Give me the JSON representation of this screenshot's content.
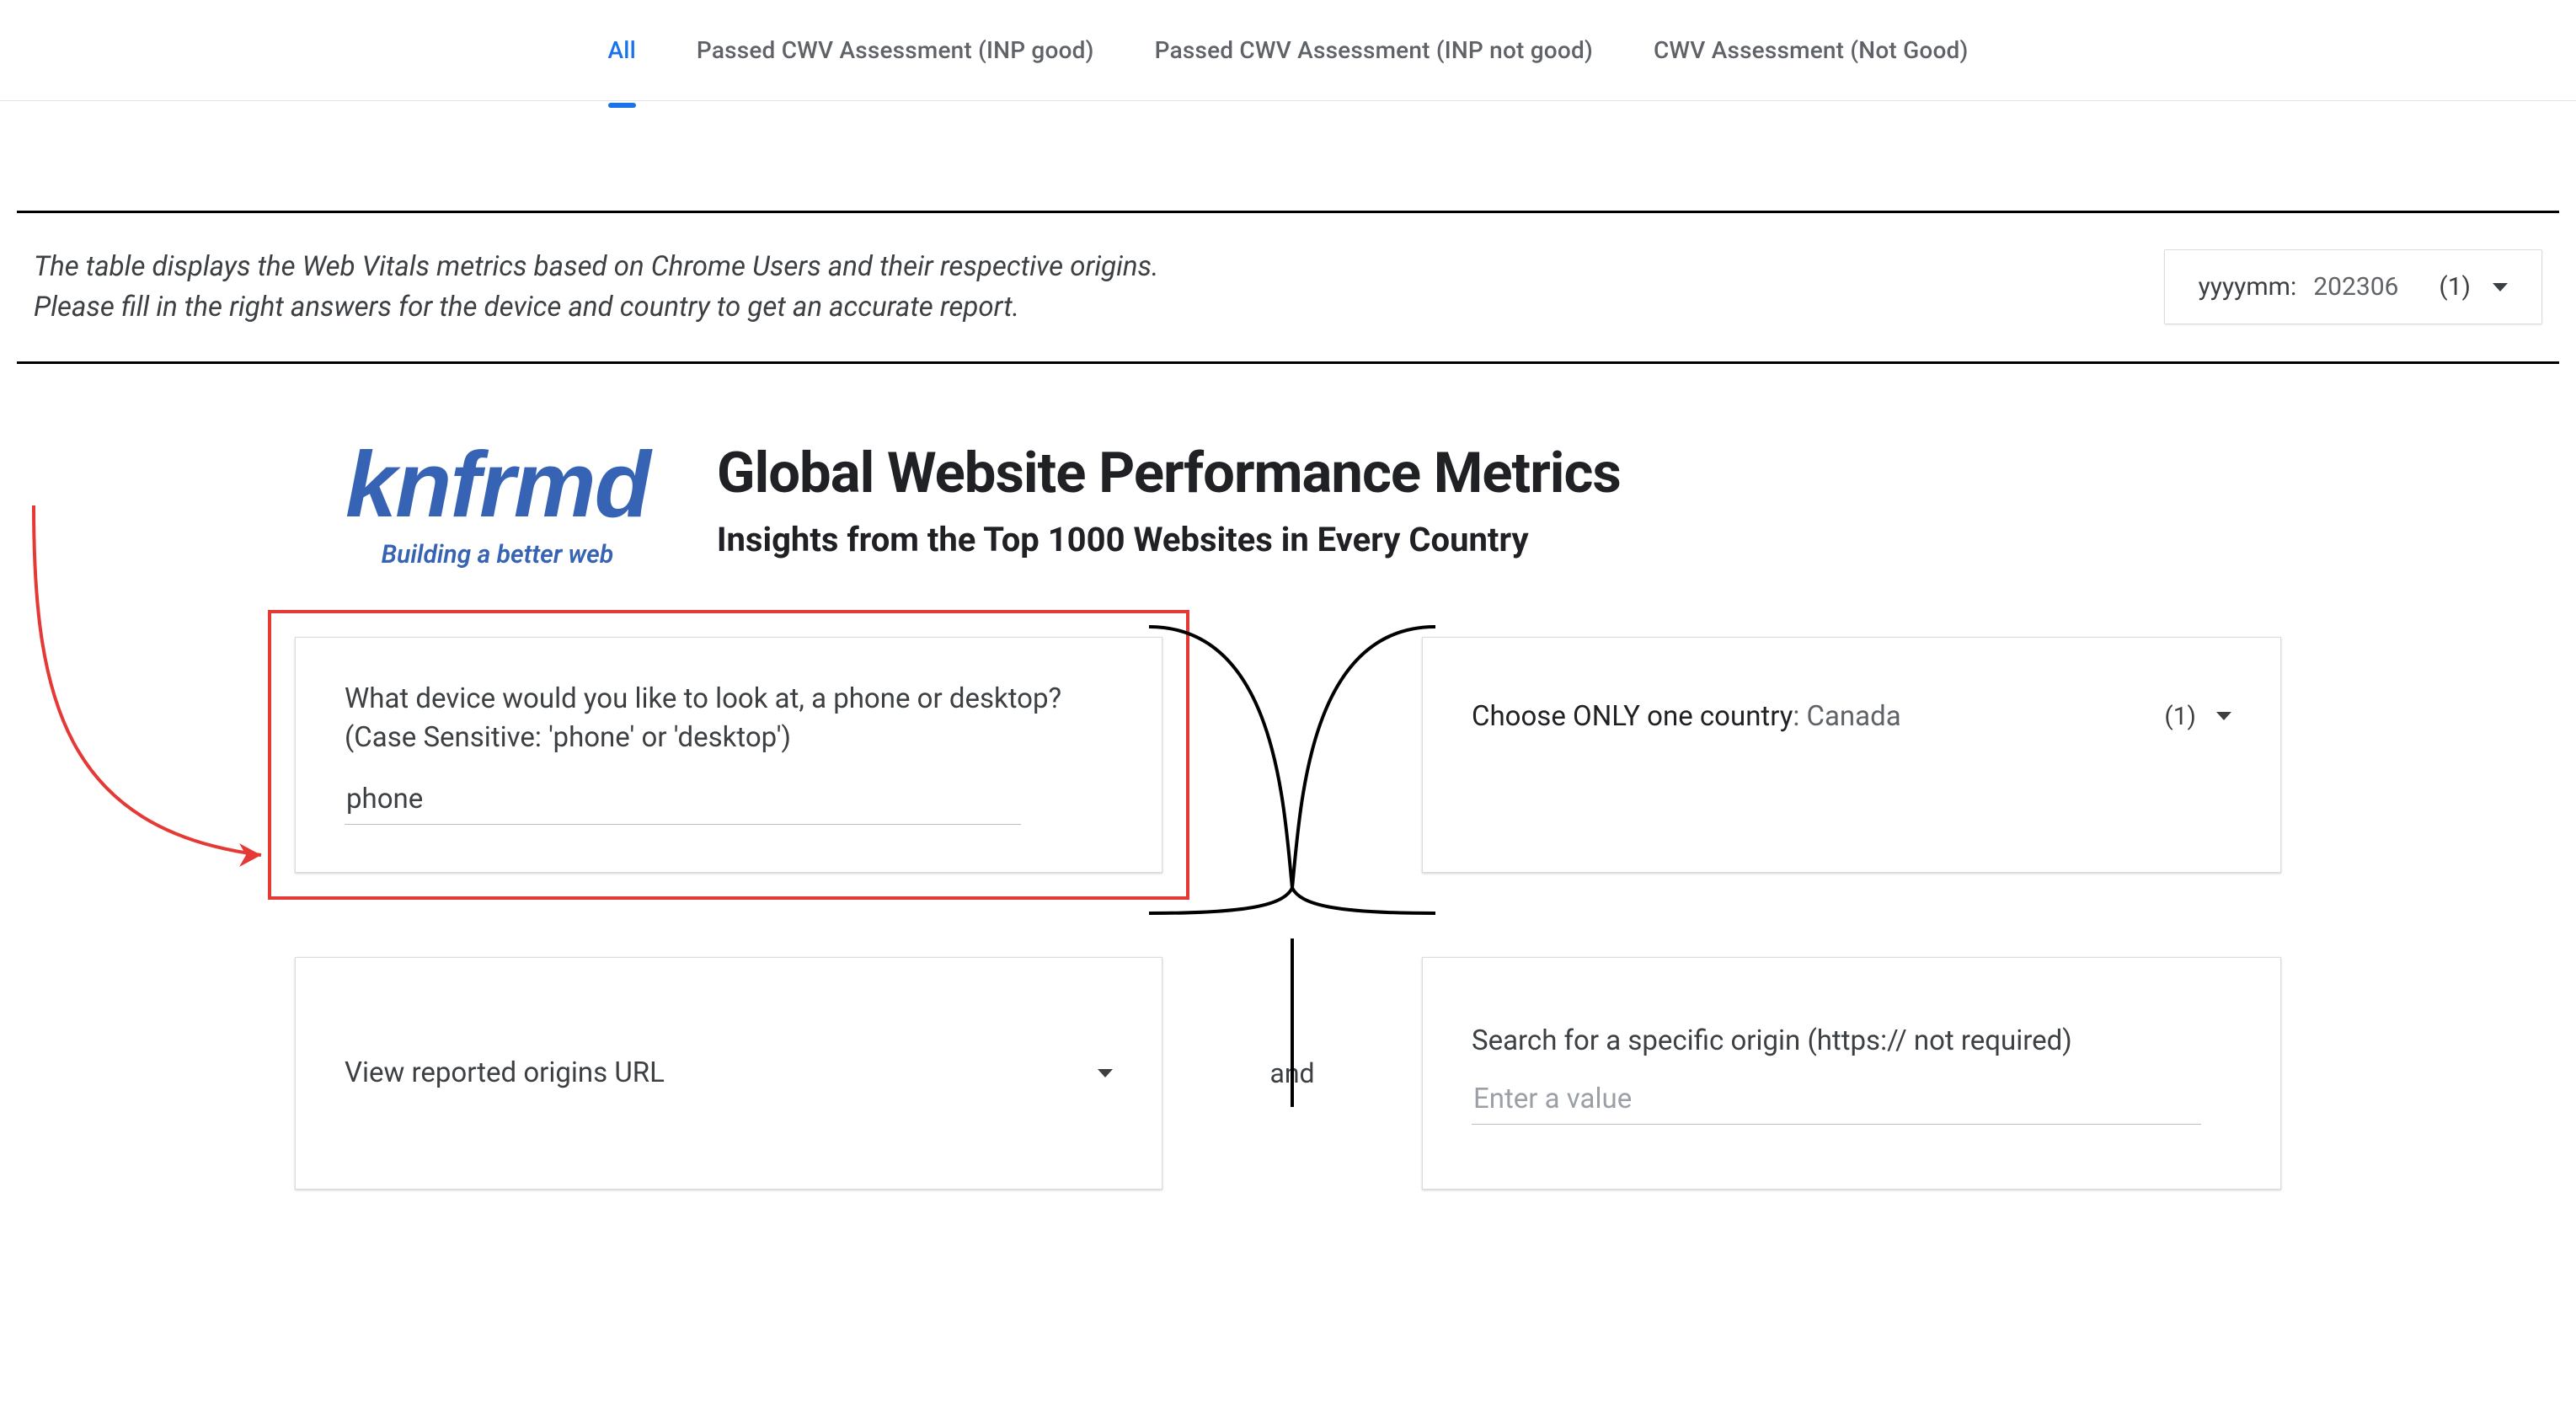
{
  "tabs": {
    "all": "All",
    "t1": "Passed CWV Assessment (INP good)",
    "t2": "Passed CWV Assessment (INP not good)",
    "t3": "CWV Assessment (Not Good)"
  },
  "intro": {
    "line1": "The table displays the Web Vitals metrics based on Chrome Users and their respective origins.",
    "line2": "Please fill in the right answers for the device and country to get an accurate report."
  },
  "date_picker": {
    "label": "yyyymm",
    "value": "202306",
    "count": "(1)"
  },
  "logo": {
    "word": "knfrmd",
    "tagline": "Building a better web"
  },
  "headline": {
    "title": "Global Website Performance Metrics",
    "subtitle": "Insights from the Top 1000 Websites in Every Country"
  },
  "device_card": {
    "question": "What device would you like to look at, a phone or desktop? (Case Sensitive: 'phone' or 'desktop')",
    "value": "phone"
  },
  "country_card": {
    "label": "Choose ONLY one country",
    "value": "Canada",
    "count": "(1)"
  },
  "origins_card": {
    "label": "View reported origins URL"
  },
  "search_card": {
    "label": "Search for a specific origin (https:// not required)",
    "placeholder": "Enter a value"
  },
  "and_label": "and"
}
